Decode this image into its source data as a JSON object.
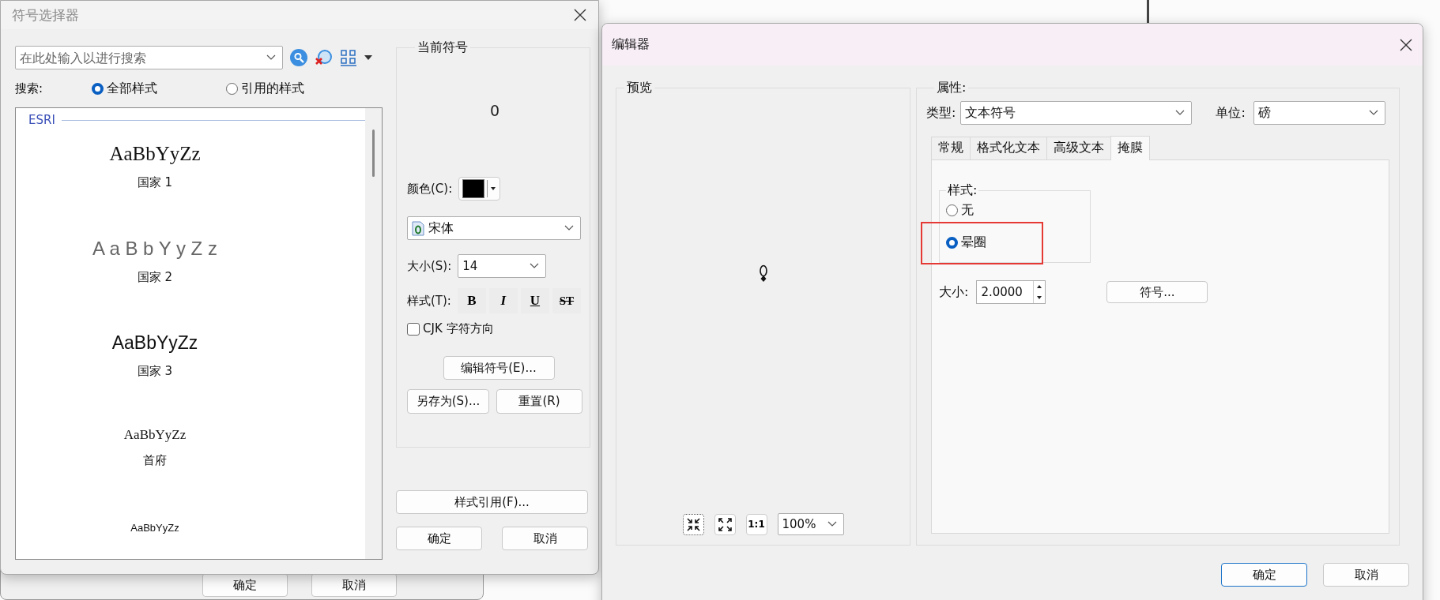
{
  "symbol_selector": {
    "title": "符号选择器",
    "search": {
      "placeholder": "在此处输入以进行搜索"
    },
    "search_scope": {
      "label": "搜索:",
      "options": [
        {
          "label": "全部样式",
          "selected": true
        },
        {
          "label": "引用的样式",
          "selected": false
        }
      ]
    },
    "gallery": {
      "group": "ESRI",
      "items": [
        {
          "sample": "AaBbYyZz",
          "name": "国家 1",
          "kind": "serif"
        },
        {
          "sample": "A a B b Y y Z z",
          "name": "国家 2",
          "kind": "spaced"
        },
        {
          "sample": "AaBbYyZz",
          "name": "国家 3",
          "kind": "sans"
        },
        {
          "sample": "AaBbYyZz",
          "name": "首府",
          "kind": "serif-small"
        },
        {
          "sample": "AaBbYyZz",
          "kind": "sans-small"
        }
      ]
    },
    "current_symbol": {
      "title": "当前符号",
      "preview": "0",
      "color": {
        "label": "颜色(C):",
        "color": "#000000"
      },
      "font": "宋体",
      "size": {
        "label": "大小(S):",
        "value": "14"
      },
      "style": {
        "label": "样式(T):",
        "buttons": [
          {
            "label": "B",
            "kind": "bold"
          },
          {
            "label": "I",
            "kind": "italic"
          },
          {
            "label": "U",
            "kind": "underline"
          },
          {
            "label": "ST",
            "kind": "strike"
          }
        ]
      },
      "cjk": {
        "label": "CJK 字符方向",
        "checked": false
      },
      "edit_button": "编辑符号(E)...",
      "save_as_button": "另存为(S)...",
      "reset_button": "重置(R)"
    },
    "style_reference_button": "样式引用(F)...",
    "ok_button": "确定",
    "cancel_button": "取消"
  },
  "background_window": {
    "ok_button": "确定",
    "cancel_button": "取消"
  },
  "editor": {
    "title": "编辑器",
    "preview": {
      "title": "预览",
      "zoom": "100%",
      "actual_size_button": "1:1"
    },
    "properties": {
      "title": "属性:",
      "type": {
        "label": "类型:",
        "value": "文本符号"
      },
      "unit": {
        "label": "单位:",
        "value": "磅"
      },
      "tabs": [
        {
          "label": "常规",
          "selected": false
        },
        {
          "label": "格式化文本",
          "selected": false
        },
        {
          "label": "高级文本",
          "selected": false
        },
        {
          "label": "掩膜",
          "selected": true
        }
      ],
      "mask_style": {
        "title": "样式:",
        "options": [
          {
            "label": "无",
            "selected": false
          },
          {
            "label": "晕圈",
            "selected": true
          }
        ]
      },
      "size": {
        "label": "大小:",
        "value": "2.0000"
      },
      "symbol_button": "符号..."
    },
    "ok_button": "确定",
    "cancel_button": "取消"
  }
}
